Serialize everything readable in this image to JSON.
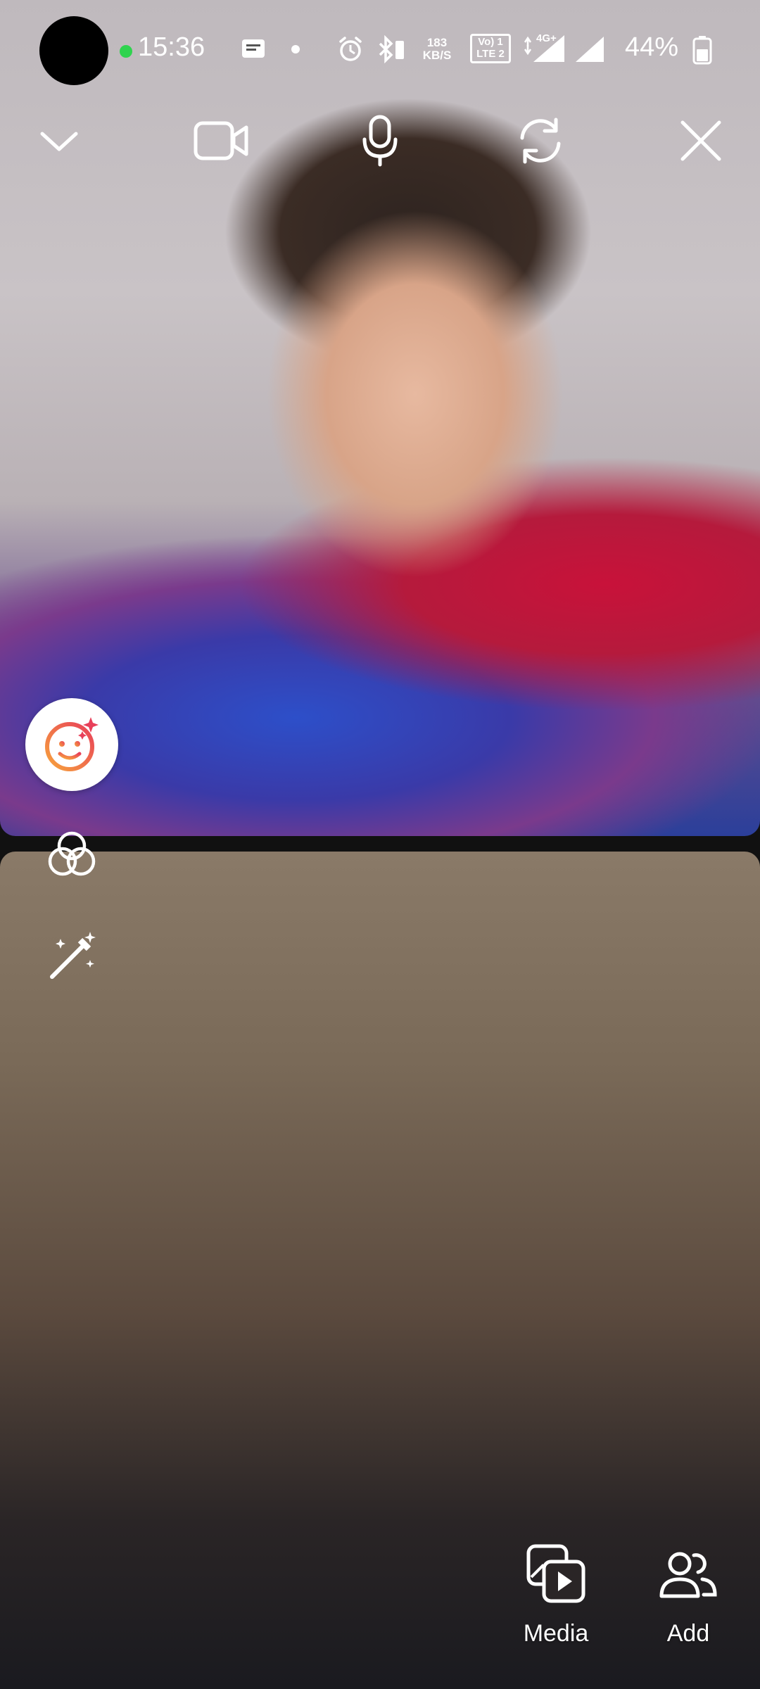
{
  "status_bar": {
    "time": "15:36",
    "net_speed_value": "183",
    "net_speed_unit": "KB/S",
    "volte_line1": "Vo) 1",
    "volte_line2": "LTE 2",
    "network_type": "4G+",
    "battery_percent": "44%",
    "icons": [
      "notification-icon",
      "dot-icon",
      "alarm-icon",
      "bluetooth-icon",
      "signal-icon",
      "battery-icon"
    ]
  },
  "call_controls": {
    "icons": [
      "chevron-down-icon",
      "video-camera-icon",
      "microphone-icon",
      "flip-camera-icon",
      "close-icon"
    ]
  },
  "side_tools": {
    "icons": [
      "face-effects-icon",
      "filters-icon",
      "magic-wand-icon"
    ]
  },
  "actions": {
    "media_label": "Media",
    "add_label": "Add"
  },
  "colors": {
    "recording_dot": "#2fd34e",
    "effects_gradient_start": "#f7a33c",
    "effects_gradient_end": "#e8405a"
  }
}
